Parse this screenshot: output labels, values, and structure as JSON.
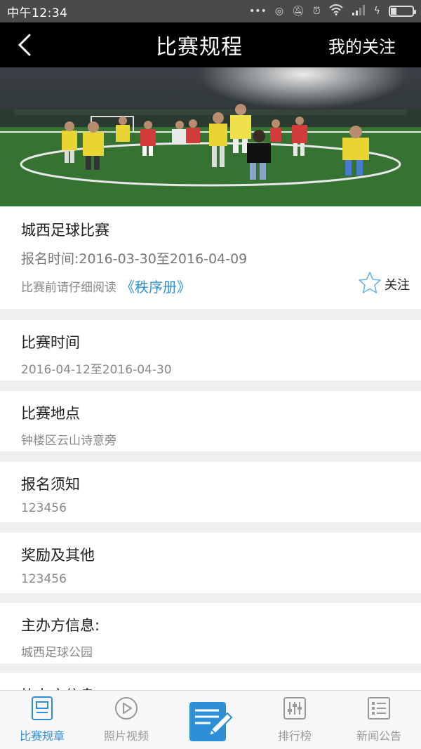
{
  "status_bar": {
    "time": "中午12:34",
    "icons": [
      "dots-icon",
      "data-icon",
      "mute-icon",
      "alarm-icon",
      "wifi-icon",
      "signal-icon",
      "charging-icon",
      "battery-icon"
    ]
  },
  "header": {
    "back_icon": "chevron-left-icon",
    "title": "比赛规程",
    "follow_link": "我的关注"
  },
  "event": {
    "name": "城西足球比赛",
    "signup_time": "报名时间:2016-03-30至2016-04-09",
    "read_prompt": "比赛前请仔细阅读",
    "rules_link": "《秩序册》",
    "follow_label": "关注"
  },
  "sections": [
    {
      "label": "比赛时间",
      "value": "2016-04-12至2016-04-30"
    },
    {
      "label": "比赛地点",
      "value": "钟楼区云山诗意旁"
    },
    {
      "label": "报名须知",
      "value": "123456"
    },
    {
      "label": "奖励及其他",
      "value": "123456"
    },
    {
      "label": "主办方信息:",
      "value": "城西足球公园"
    },
    {
      "label": "协办方信息",
      "value": ""
    }
  ],
  "bottom_nav": [
    {
      "label": "比赛规章",
      "icon": "rules-icon",
      "active": true
    },
    {
      "label": "照片视频",
      "icon": "play-icon",
      "active": false
    },
    {
      "label": "",
      "icon": "edit-note-icon",
      "active": false
    },
    {
      "label": "排行榜",
      "icon": "ranking-icon",
      "active": false
    },
    {
      "label": "新闻公告",
      "icon": "news-list-icon",
      "active": false
    }
  ],
  "colors": {
    "accent": "#2f8fd6",
    "header_bg": "#000000",
    "status_bg": "#4a4a4a"
  }
}
